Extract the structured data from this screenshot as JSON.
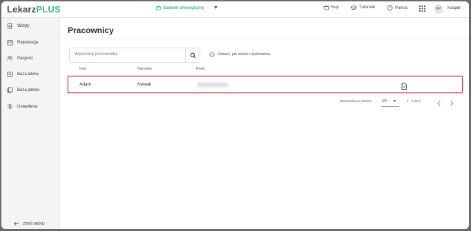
{
  "logo": {
    "part1": "Lekarz",
    "part2": "PLUS"
  },
  "clinic": {
    "label": "Gabinet chirurgiczny"
  },
  "topnav": {
    "kup": "Kup",
    "tutoriale": "Tutoriale",
    "pomoc": "Pomoc",
    "avatar_initials": "KP",
    "username": "Kacper"
  },
  "sidebar": {
    "items": [
      {
        "label": "Wizyty",
        "icon": "clipboard-icon"
      },
      {
        "label": "Rejestracja",
        "icon": "calendar-icon"
      },
      {
        "label": "Pacjenci",
        "icon": "people-icon"
      },
      {
        "label": "Baza leków",
        "icon": "plus-box-icon"
      },
      {
        "label": "Baza plików",
        "icon": "files-icon"
      },
      {
        "label": "Ustawienia",
        "icon": "gear-icon"
      }
    ],
    "collapse_label": "ZWIŃ MENU"
  },
  "page": {
    "title": "Pracownicy"
  },
  "search": {
    "placeholder": "Wyszukaj pracownika"
  },
  "help": {
    "label": "Zobacz, jak dodać użytkownika"
  },
  "table": {
    "headers": [
      "Imię",
      "Nazwisko",
      "Pesel"
    ],
    "rows": [
      {
        "first_name": "Adam",
        "last_name": "Nowak"
      }
    ]
  },
  "pagination": {
    "per_page_label": "Elementów na stronie",
    "per_page_value": "10",
    "range": "1 - 1 do 1"
  },
  "colors": {
    "brand": "#3cb88a",
    "highlight": "#e23b3b"
  }
}
